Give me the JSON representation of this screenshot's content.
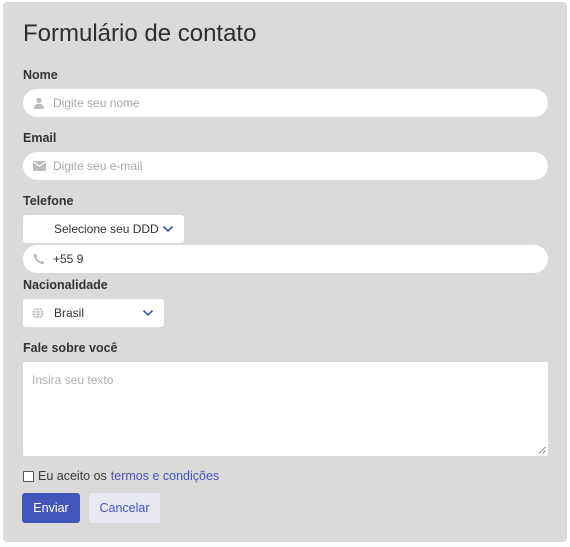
{
  "form": {
    "title": "Formulário de contato",
    "name": {
      "label": "Nome",
      "placeholder": "Digite seu nome",
      "icon": "user-icon"
    },
    "email": {
      "label": "Email",
      "placeholder": "Digite seu e-mail",
      "icon": "envelope-icon"
    },
    "phone": {
      "label": "Telefone",
      "ddd_select": "Selecione seu DDD",
      "value": "+55 9",
      "icon": "phone-icon"
    },
    "nationality": {
      "label": "Nacionalidade",
      "selected": "Brasil",
      "icon": "globe-icon"
    },
    "about": {
      "label": "Fale sobre você",
      "placeholder": "Insira seu texto"
    },
    "terms": {
      "checked": false,
      "text": "Eu aceito os",
      "link": "termos e condições"
    },
    "buttons": {
      "submit": "Enviar",
      "cancel": "Cancelar"
    }
  },
  "colors": {
    "background": "#dcdad9",
    "accent": "#4355b8",
    "secondary_button": "#e8e8f2"
  }
}
